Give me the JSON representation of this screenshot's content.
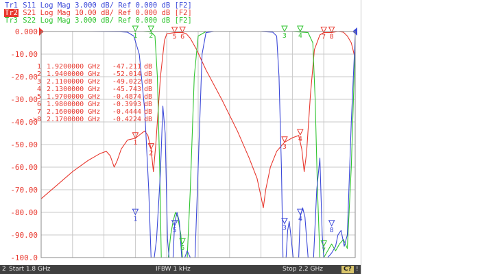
{
  "trace_header": [
    {
      "tag": "Tr1",
      "text": "S11 Log Mag 3.000 dB/ Ref 0.000 dB [F2]",
      "color": "#3b48d8",
      "active": false
    },
    {
      "tag": "Tr2",
      "text": "S21 Log Mag 10.00 dB/ Ref 0.000 dB [F2]",
      "color": "#e8382e",
      "active": true
    },
    {
      "tag": "Tr3",
      "text": "S22 Log Mag 3.000 dB/ Ref 0.000 dB [F2]",
      "color": "#2fc42f",
      "active": false
    }
  ],
  "marker_table": [
    {
      "id": "1",
      "freq": "1.9200000 GHz",
      "value": "-47.211",
      "unit": "dB"
    },
    {
      "id": "2",
      "freq": "1.9400000 GHz",
      "value": "-52.014",
      "unit": "dB"
    },
    {
      "id": "3",
      "freq": "2.1100000 GHz",
      "value": "-49.022",
      "unit": "dB"
    },
    {
      "id": "4",
      "freq": "2.1300000 GHz",
      "value": "-45.743",
      "unit": "dB"
    },
    {
      "id": "5",
      "freq": "1.9700000 GHz",
      "value": "-0.4874",
      "unit": "dB"
    },
    {
      "id": "6",
      "freq": "1.9800000 GHz",
      "value": "-0.3993",
      "unit": "dB"
    },
    {
      "id": "7",
      "freq": "2.1600000 GHz",
      "value": "-0.4444",
      "unit": "dB"
    },
    {
      "id": ">8",
      "freq": "2.1700000 GHz",
      "value": "-0.4224",
      "unit": "dB"
    }
  ],
  "status_bar": {
    "channel": "2",
    "start": "Start 1.8 GHz",
    "ifbw": "IFBW 1 kHz",
    "stop": "Stop 2.2 GHz",
    "badge": "C?",
    "end_mark": "!"
  },
  "colors": {
    "s11": "#3b48d8",
    "s21": "#e8382e",
    "s22": "#2fc42f",
    "grid": "#c8c8c8",
    "axis_labels": "#e8382e"
  },
  "chart_data": {
    "type": "line",
    "x_unit": "GHz",
    "xlim": [
      1.8,
      2.2
    ],
    "ylim": [
      -100,
      0
    ],
    "grid": true,
    "yticks": [
      {
        "value": 0,
        "label": "0.000"
      },
      {
        "value": -10,
        "label": "-10.00"
      },
      {
        "value": -20,
        "label": "-20.00"
      },
      {
        "value": -30,
        "label": "-30.00"
      },
      {
        "value": -40,
        "label": "-40.00"
      },
      {
        "value": -50,
        "label": "-50.00"
      },
      {
        "value": -60,
        "label": "-60.00"
      },
      {
        "value": -70,
        "label": "-70.00"
      },
      {
        "value": -80,
        "label": "-80.00"
      },
      {
        "value": -90,
        "label": "-90.00"
      },
      {
        "value": -100,
        "label": "-100.0"
      }
    ],
    "series": [
      {
        "name": "S21",
        "color": "#e8382e",
        "points": [
          [
            1.8,
            -74
          ],
          [
            1.82,
            -68
          ],
          [
            1.84,
            -62
          ],
          [
            1.86,
            -57
          ],
          [
            1.875,
            -54
          ],
          [
            1.883,
            -53
          ],
          [
            1.888,
            -55
          ],
          [
            1.893,
            -60
          ],
          [
            1.897,
            -57
          ],
          [
            1.902,
            -52
          ],
          [
            1.91,
            -48
          ],
          [
            1.92,
            -47.2
          ],
          [
            1.928,
            -45
          ],
          [
            1.932,
            -44
          ],
          [
            1.936,
            -46
          ],
          [
            1.94,
            -52
          ],
          [
            1.943,
            -62
          ],
          [
            1.946,
            -50
          ],
          [
            1.952,
            -20
          ],
          [
            1.957,
            -4
          ],
          [
            1.96,
            -1
          ],
          [
            1.97,
            -0.5
          ],
          [
            1.98,
            -0.4
          ],
          [
            1.985,
            -1
          ],
          [
            1.99,
            -3
          ],
          [
            1.998,
            -8
          ],
          [
            2.01,
            -17
          ],
          [
            2.03,
            -30
          ],
          [
            2.05,
            -44
          ],
          [
            2.065,
            -56
          ],
          [
            2.075,
            -65
          ],
          [
            2.08,
            -73
          ],
          [
            2.083,
            -78
          ],
          [
            2.086,
            -70
          ],
          [
            2.092,
            -60
          ],
          [
            2.1,
            -53
          ],
          [
            2.11,
            -49
          ],
          [
            2.12,
            -47
          ],
          [
            2.128,
            -46
          ],
          [
            2.132,
            -52
          ],
          [
            2.135,
            -62
          ],
          [
            2.138,
            -54
          ],
          [
            2.143,
            -28
          ],
          [
            2.148,
            -8
          ],
          [
            2.155,
            -1.5
          ],
          [
            2.16,
            -0.45
          ],
          [
            2.17,
            -0.42
          ],
          [
            2.178,
            0
          ],
          [
            2.185,
            -0.3
          ],
          [
            2.19,
            -2
          ],
          [
            2.195,
            -5
          ],
          [
            2.2,
            -12
          ]
        ]
      },
      {
        "name": "S11",
        "color": "#3b48d8",
        "points": [
          [
            1.8,
            0
          ],
          [
            1.86,
            0
          ],
          [
            1.9,
            -0.1
          ],
          [
            1.91,
            -0.3
          ],
          [
            1.918,
            -2
          ],
          [
            1.925,
            -10
          ],
          [
            1.932,
            -35
          ],
          [
            1.937,
            -70
          ],
          [
            1.94,
            -100
          ],
          [
            1.944,
            -100
          ],
          [
            1.947,
            -92
          ],
          [
            1.952,
            -62
          ],
          [
            1.955,
            -33
          ],
          [
            1.958,
            -45
          ],
          [
            1.961,
            -92
          ],
          [
            1.963,
            -100
          ],
          [
            1.968,
            -100
          ],
          [
            1.97,
            -85
          ],
          [
            1.973,
            -80
          ],
          [
            1.976,
            -84
          ],
          [
            1.979,
            -100
          ],
          [
            1.983,
            -100
          ],
          [
            1.986,
            -97
          ],
          [
            1.99,
            -100
          ],
          [
            1.996,
            -100
          ],
          [
            2.0,
            -60
          ],
          [
            2.005,
            -10
          ],
          [
            2.01,
            -0.5
          ],
          [
            2.02,
            0
          ],
          [
            2.08,
            0
          ],
          [
            2.095,
            -0.3
          ],
          [
            2.1,
            -2
          ],
          [
            2.103,
            -20
          ],
          [
            2.106,
            -60
          ],
          [
            2.108,
            -100
          ],
          [
            2.112,
            -100
          ],
          [
            2.114,
            -88
          ],
          [
            2.116,
            -84
          ],
          [
            2.118,
            -90
          ],
          [
            2.121,
            -100
          ],
          [
            2.128,
            -100
          ],
          [
            2.13,
            -82
          ],
          [
            2.133,
            -78
          ],
          [
            2.136,
            -82
          ],
          [
            2.14,
            -100
          ],
          [
            2.147,
            -100
          ],
          [
            2.151,
            -70
          ],
          [
            2.155,
            -56
          ],
          [
            2.158,
            -90
          ],
          [
            2.16,
            -100
          ],
          [
            2.165,
            -100
          ],
          [
            2.17,
            -98
          ],
          [
            2.175,
            -95
          ],
          [
            2.178,
            -90
          ],
          [
            2.182,
            -88
          ],
          [
            2.186,
            -95
          ],
          [
            2.19,
            -90
          ],
          [
            2.195,
            -40
          ],
          [
            2.2,
            -2
          ]
        ]
      },
      {
        "name": "S22",
        "color": "#2fc42f",
        "points": [
          [
            1.8,
            0
          ],
          [
            1.93,
            0
          ],
          [
            1.94,
            -0.2
          ],
          [
            1.945,
            -2
          ],
          [
            1.948,
            -20
          ],
          [
            1.951,
            -60
          ],
          [
            1.953,
            -100
          ],
          [
            1.962,
            -100
          ],
          [
            1.965,
            -90
          ],
          [
            1.968,
            -84
          ],
          [
            1.971,
            -80
          ],
          [
            1.974,
            -82
          ],
          [
            1.978,
            -90
          ],
          [
            1.98,
            -100
          ],
          [
            1.986,
            -100
          ],
          [
            1.99,
            -70
          ],
          [
            1.995,
            -20
          ],
          [
            2.0,
            -2
          ],
          [
            2.01,
            0
          ],
          [
            2.12,
            0
          ],
          [
            2.14,
            -0.5
          ],
          [
            2.146,
            -5
          ],
          [
            2.149,
            -30
          ],
          [
            2.152,
            -70
          ],
          [
            2.155,
            -100
          ],
          [
            2.16,
            -100
          ],
          [
            2.165,
            -97
          ],
          [
            2.17,
            -94
          ],
          [
            2.175,
            -97
          ],
          [
            2.18,
            -94
          ],
          [
            2.185,
            -92
          ],
          [
            2.19,
            -96
          ],
          [
            2.195,
            -60
          ],
          [
            2.2,
            -5
          ]
        ]
      }
    ],
    "markers": [
      {
        "label": "1",
        "series": "S21",
        "x": 1.92,
        "y": -47.211
      },
      {
        "label": "2",
        "series": "S21",
        "x": 1.94,
        "y": -52.014
      },
      {
        "label": "3",
        "series": "S21",
        "x": 2.11,
        "y": -49.022
      },
      {
        "label": "4",
        "series": "S21",
        "x": 2.13,
        "y": -45.743
      },
      {
        "label": "5",
        "series": "S21",
        "x": 1.97,
        "y": -0.4874
      },
      {
        "label": "6",
        "series": "S21",
        "x": 1.98,
        "y": -0.3993
      },
      {
        "label": "7",
        "series": "S21",
        "x": 2.16,
        "y": -0.4444
      },
      {
        "label": "8",
        "series": "S21",
        "x": 2.17,
        "y": -0.4224
      },
      {
        "label": "1",
        "series": "S22",
        "x": 1.92,
        "y": 0
      },
      {
        "label": "2",
        "series": "S22",
        "x": 1.94,
        "y": 0
      },
      {
        "label": "3",
        "series": "S22",
        "x": 2.11,
        "y": 0
      },
      {
        "label": "4",
        "series": "S22",
        "x": 2.13,
        "y": 0
      },
      {
        "label": "1",
        "series": "S11",
        "x": 1.92,
        "y": -81
      },
      {
        "label": "4",
        "series": "S11",
        "x": 2.13,
        "y": -81
      },
      {
        "label": "3",
        "series": "S11",
        "x": 2.11,
        "y": -85
      },
      {
        "label": "5",
        "series": "S11",
        "x": 1.97,
        "y": -86
      },
      {
        "label": "8",
        "series": "S11",
        "x": 2.17,
        "y": -86
      },
      {
        "label": "6",
        "series": "S22",
        "x": 1.98,
        "y": -94
      },
      {
        "label": "7",
        "series": "S22",
        "x": 2.16,
        "y": -95
      }
    ]
  }
}
